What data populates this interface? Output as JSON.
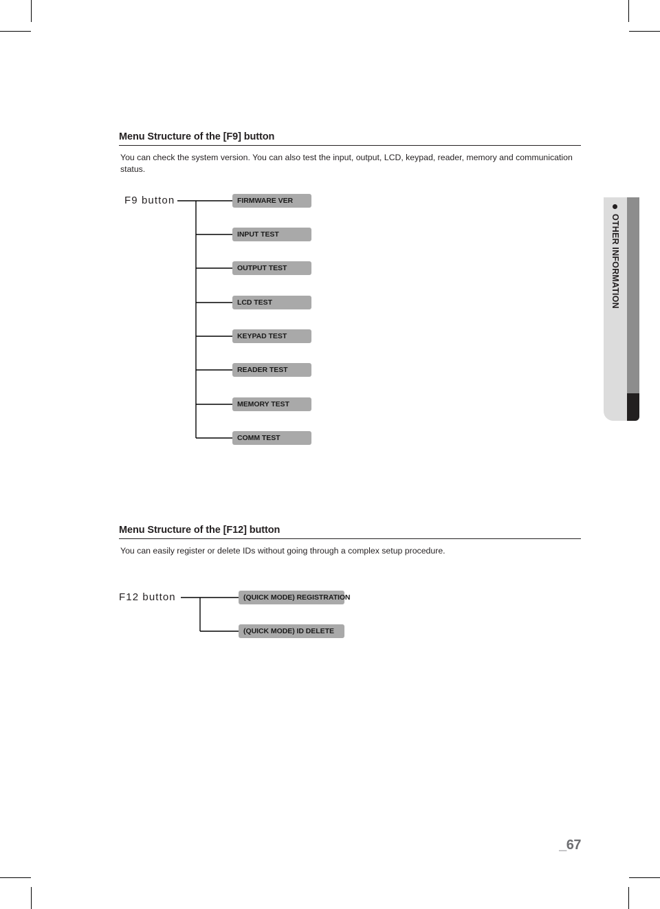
{
  "crop_marks": {
    "present": true
  },
  "side_tab": {
    "bullet_icon": "bullet-dot-icon",
    "label": "OTHER INFORMATION"
  },
  "sections": [
    {
      "id": "f9",
      "heading": "Menu Structure of the [F9] button",
      "intro": "You can check the system version. You can also test the input, output, LCD, keypad, reader, memory and communication status.",
      "tree": {
        "root_label": "F9 button",
        "items": [
          {
            "label": "FIRMWARE VER"
          },
          {
            "label": "INPUT TEST"
          },
          {
            "label": "OUTPUT TEST"
          },
          {
            "label": "LCD TEST"
          },
          {
            "label": "KEYPAD TEST"
          },
          {
            "label": "READER TEST"
          },
          {
            "label": "MEMORY TEST"
          },
          {
            "label": "COMM TEST"
          }
        ]
      }
    },
    {
      "id": "f12",
      "heading": "Menu Structure of the [F12] button",
      "intro": "You can easily register or delete IDs without going through a complex setup procedure.",
      "tree": {
        "root_label": "F12 button",
        "items": [
          {
            "label": "(QUICK MODE) REGISTRATION"
          },
          {
            "label": "(QUICK MODE) ID DELETE"
          }
        ]
      }
    }
  ],
  "footer": {
    "page_number": "_67"
  },
  "colors": {
    "node_fill": "#a9a9a9",
    "tab_light": "#dcdcdc",
    "tab_gray": "#8d8d8d",
    "tab_dark": "#221f1f",
    "text": "#231f20",
    "page_number": "#6d6e71"
  }
}
